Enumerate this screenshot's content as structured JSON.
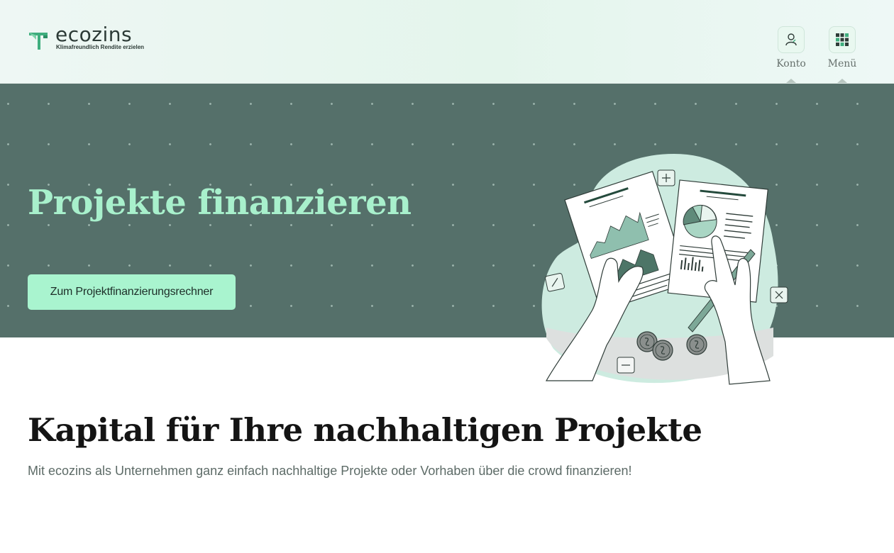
{
  "brand": {
    "name": "ecozins",
    "tagline": "Klimafreundlich Rendite erzielen",
    "accent_color": "#a9f4cf",
    "hero_background": "#55706a"
  },
  "header": {
    "account": {
      "label": "Konto",
      "icon": "user-icon"
    },
    "menu": {
      "label": "Menü",
      "icon": "grid-menu-icon"
    }
  },
  "hero": {
    "title": "Projekte finanzieren",
    "cta_label": "Zum Projektfinanzierungsrechner",
    "illustration": "hands-holding-financial-reports-illustration"
  },
  "main": {
    "heading": "Kapital für Ihre nachhaltigen Projekte",
    "subheading": "Mit ecozins als Unternehmen ganz einfach nachhaltige Projekte oder Vorhaben über die crowd finanzieren!"
  }
}
